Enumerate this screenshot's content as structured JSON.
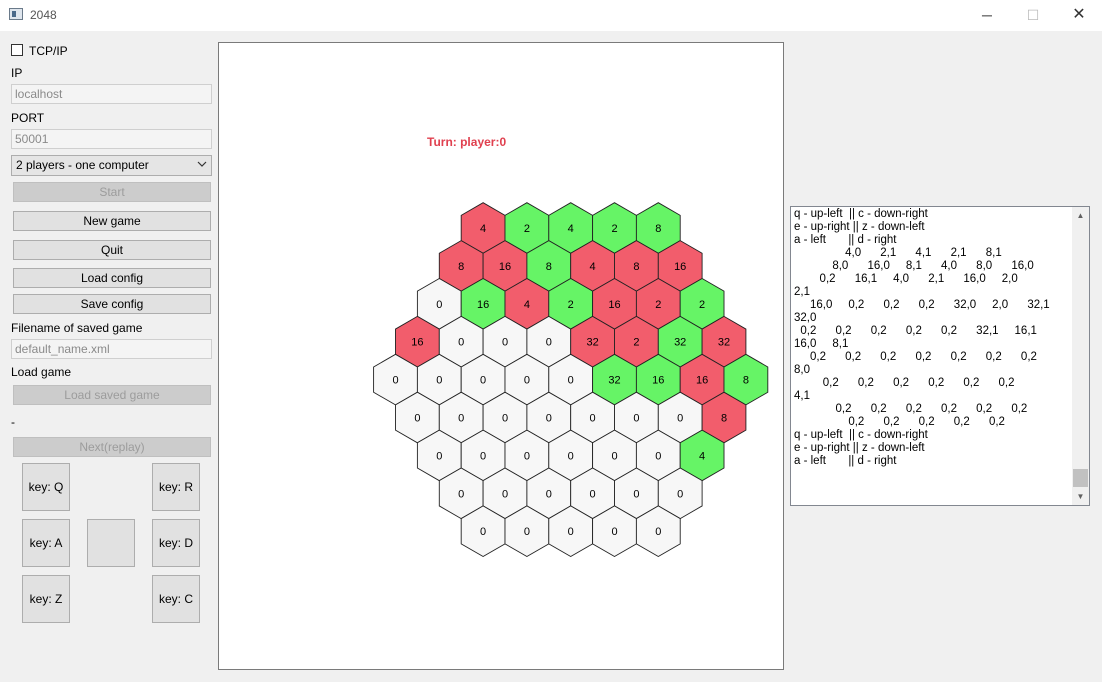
{
  "window": {
    "title": "2048",
    "minimize": "─",
    "maximize": "☐",
    "close": "✕"
  },
  "panel": {
    "tcp_checkbox": {
      "label": "TCP/IP",
      "checked": false
    },
    "ip_label": "IP",
    "ip_value": "localhost",
    "port_label": "PORT",
    "port_value": "50001",
    "mode_select": "2 players - one computer",
    "start_button": "Start",
    "new_game_button": "New game",
    "quit_button": "Quit",
    "load_config_button": "Load config",
    "save_config_button": "Save config",
    "filename_label": "Filename of saved game",
    "filename_value": "default_name.xml",
    "load_game_label": "Load game",
    "load_saved_button": "Load saved game",
    "dash_label": "-",
    "next_replay_button": "Next(replay)",
    "keys": {
      "q": "key: Q",
      "r": "key: R",
      "a": "key: A",
      "d": "key: D",
      "z": "key: Z",
      "c": "key: C"
    }
  },
  "board": {
    "turn_text": "Turn: player:0",
    "colors": {
      "red": "#f25d6c",
      "green": "#66f466",
      "empty": "#f7f7f7",
      "turn": "#e0404f"
    },
    "rows": [
      [
        {
          "v": "4",
          "o": "r"
        },
        {
          "v": "2",
          "o": "g"
        },
        {
          "v": "4",
          "o": "g"
        },
        {
          "v": "2",
          "o": "g"
        },
        {
          "v": "8",
          "o": "g"
        }
      ],
      [
        {
          "v": "8",
          "o": "r"
        },
        {
          "v": "16",
          "o": "r"
        },
        {
          "v": "8",
          "o": "g"
        },
        {
          "v": "4",
          "o": "r"
        },
        {
          "v": "8",
          "o": "r"
        },
        {
          "v": "16",
          "o": "r"
        }
      ],
      [
        {
          "v": "0",
          "o": "e"
        },
        {
          "v": "16",
          "o": "g"
        },
        {
          "v": "4",
          "o": "r"
        },
        {
          "v": "2",
          "o": "g"
        },
        {
          "v": "16",
          "o": "r"
        },
        {
          "v": "2",
          "o": "r"
        },
        {
          "v": "2",
          "o": "g"
        }
      ],
      [
        {
          "v": "16",
          "o": "r"
        },
        {
          "v": "0",
          "o": "e"
        },
        {
          "v": "0",
          "o": "e"
        },
        {
          "v": "0",
          "o": "e"
        },
        {
          "v": "32",
          "o": "r"
        },
        {
          "v": "2",
          "o": "r"
        },
        {
          "v": "32",
          "o": "g"
        },
        {
          "v": "32",
          "o": "r"
        }
      ],
      [
        {
          "v": "0",
          "o": "e"
        },
        {
          "v": "0",
          "o": "e"
        },
        {
          "v": "0",
          "o": "e"
        },
        {
          "v": "0",
          "o": "e"
        },
        {
          "v": "0",
          "o": "e"
        },
        {
          "v": "32",
          "o": "g"
        },
        {
          "v": "16",
          "o": "g"
        },
        {
          "v": "16",
          "o": "r"
        },
        {
          "v": "8",
          "o": "g"
        }
      ],
      [
        {
          "v": "0",
          "o": "e"
        },
        {
          "v": "0",
          "o": "e"
        },
        {
          "v": "0",
          "o": "e"
        },
        {
          "v": "0",
          "o": "e"
        },
        {
          "v": "0",
          "o": "e"
        },
        {
          "v": "0",
          "o": "e"
        },
        {
          "v": "0",
          "o": "e"
        },
        {
          "v": "8",
          "o": "r"
        }
      ],
      [
        {
          "v": "0",
          "o": "e"
        },
        {
          "v": "0",
          "o": "e"
        },
        {
          "v": "0",
          "o": "e"
        },
        {
          "v": "0",
          "o": "e"
        },
        {
          "v": "0",
          "o": "e"
        },
        {
          "v": "0",
          "o": "e"
        },
        {
          "v": "4",
          "o": "g"
        }
      ],
      [
        {
          "v": "0",
          "o": "e"
        },
        {
          "v": "0",
          "o": "e"
        },
        {
          "v": "0",
          "o": "e"
        },
        {
          "v": "0",
          "o": "e"
        },
        {
          "v": "0",
          "o": "e"
        },
        {
          "v": "0",
          "o": "e"
        }
      ],
      [
        {
          "v": "0",
          "o": "e"
        },
        {
          "v": "0",
          "o": "e"
        },
        {
          "v": "0",
          "o": "e"
        },
        {
          "v": "0",
          "o": "e"
        },
        {
          "v": "0",
          "o": "e"
        }
      ]
    ]
  },
  "log": {
    "lines": [
      "q - up-left  || c - down-right",
      "e - up-right || z - down-left",
      "a - left       || d - right",
      "",
      "                4,0      2,1      4,1      2,1      8,1",
      "            8,0      16,0     8,1      4,0      8,0      16,0",
      "        0,2      16,1     4,0      2,1      16,0     2,0",
      "2,1",
      "     16,0     0,2      0,2      0,2      32,0     2,0      32,1",
      "32,0",
      "  0,2      0,2      0,2      0,2      0,2      32,1     16,1",
      "16,0     8,1",
      "     0,2      0,2      0,2      0,2      0,2      0,2      0,2",
      "8,0",
      "         0,2      0,2      0,2      0,2      0,2      0,2",
      "4,1",
      "             0,2      0,2      0,2      0,2      0,2      0,2",
      "                 0,2      0,2      0,2      0,2      0,2",
      "",
      "q - up-left  || c - down-right",
      "e - up-right || z - down-left",
      "a - left       || d - right"
    ]
  }
}
